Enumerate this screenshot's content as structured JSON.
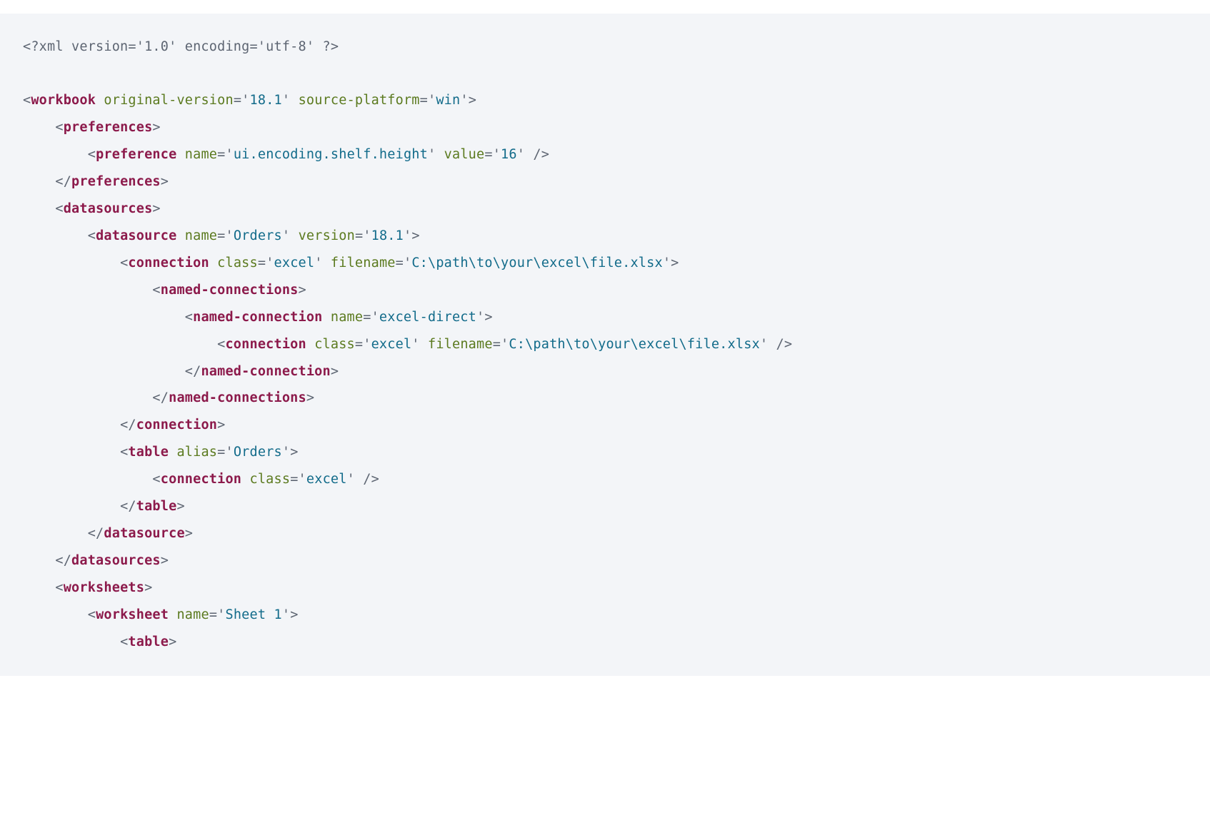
{
  "colors": {
    "bg": "#f3f5f8",
    "punct": "#5d6572",
    "tag": "#8c1a4b",
    "attr": "#5b7a1f",
    "val": "#126b8a"
  },
  "lines": [
    {
      "indent": 0,
      "kind": "decl",
      "text": "<?xml version='1.0' encoding='utf-8' ?>"
    },
    {
      "indent": 0,
      "kind": "blank"
    },
    {
      "indent": 0,
      "kind": "open",
      "tag": "workbook",
      "attrs": [
        {
          "name": "original-version",
          "value": "18.1"
        },
        {
          "name": "source-platform",
          "value": "win"
        }
      ]
    },
    {
      "indent": 1,
      "kind": "open",
      "tag": "preferences",
      "attrs": []
    },
    {
      "indent": 2,
      "kind": "self",
      "tag": "preference",
      "attrs": [
        {
          "name": "name",
          "value": "ui.encoding.shelf.height"
        },
        {
          "name": "value",
          "value": "16"
        }
      ]
    },
    {
      "indent": 1,
      "kind": "close",
      "tag": "preferences"
    },
    {
      "indent": 1,
      "kind": "open",
      "tag": "datasources",
      "attrs": []
    },
    {
      "indent": 2,
      "kind": "open",
      "tag": "datasource",
      "attrs": [
        {
          "name": "name",
          "value": "Orders"
        },
        {
          "name": "version",
          "value": "18.1"
        }
      ]
    },
    {
      "indent": 3,
      "kind": "open",
      "tag": "connection",
      "attrs": [
        {
          "name": "class",
          "value": "excel"
        },
        {
          "name": "filename",
          "value": "C:\\path\\to\\your\\excel\\file.xlsx"
        }
      ]
    },
    {
      "indent": 4,
      "kind": "open",
      "tag": "named-connections",
      "attrs": []
    },
    {
      "indent": 5,
      "kind": "open",
      "tag": "named-connection",
      "attrs": [
        {
          "name": "name",
          "value": "excel-direct"
        }
      ]
    },
    {
      "indent": 6,
      "kind": "self",
      "tag": "connection",
      "attrs": [
        {
          "name": "class",
          "value": "excel"
        },
        {
          "name": "filename",
          "value": "C:\\path\\to\\your\\excel\\file.xlsx"
        }
      ]
    },
    {
      "indent": 5,
      "kind": "close",
      "tag": "named-connection"
    },
    {
      "indent": 4,
      "kind": "close",
      "tag": "named-connections"
    },
    {
      "indent": 3,
      "kind": "close",
      "tag": "connection"
    },
    {
      "indent": 3,
      "kind": "open",
      "tag": "table",
      "attrs": [
        {
          "name": "alias",
          "value": "Orders"
        }
      ]
    },
    {
      "indent": 4,
      "kind": "self",
      "tag": "connection",
      "attrs": [
        {
          "name": "class",
          "value": "excel"
        }
      ]
    },
    {
      "indent": 3,
      "kind": "close",
      "tag": "table"
    },
    {
      "indent": 2,
      "kind": "close",
      "tag": "datasource"
    },
    {
      "indent": 1,
      "kind": "close",
      "tag": "datasources"
    },
    {
      "indent": 1,
      "kind": "open",
      "tag": "worksheets",
      "attrs": []
    },
    {
      "indent": 2,
      "kind": "open",
      "tag": "worksheet",
      "attrs": [
        {
          "name": "name",
          "value": "Sheet 1"
        }
      ]
    },
    {
      "indent": 3,
      "kind": "open",
      "tag": "table",
      "attrs": []
    }
  ]
}
